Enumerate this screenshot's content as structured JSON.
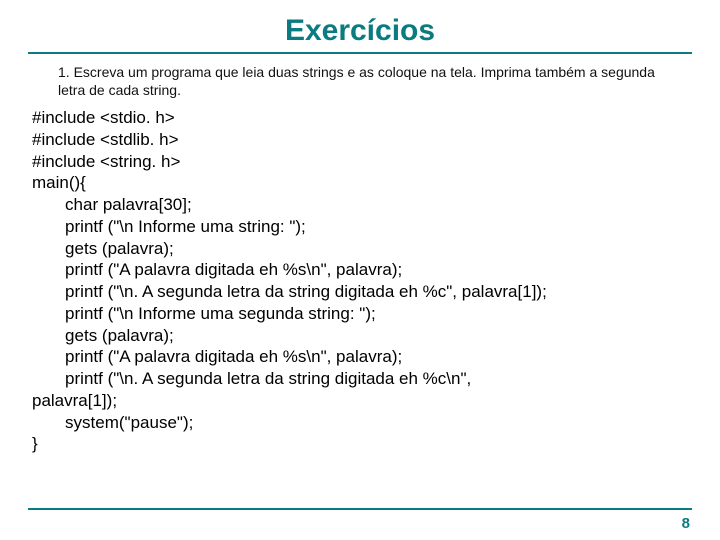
{
  "title": "Exercícios",
  "prompt": "1. Escreva um programa que leia duas strings e as coloque na tela. Imprima também a segunda letra de cada string.",
  "code": "#include <stdio. h>\n#include <stdlib. h>\n#include <string. h>\nmain(){\n       char palavra[30];\n       printf (\"\\n Informe uma string: \");\n       gets (palavra);\n       printf (\"A palavra digitada eh %s\\n\", palavra);\n       printf (\"\\n. A segunda letra da string digitada eh %c\", palavra[1]);\n       printf (\"\\n Informe uma segunda string: \");\n       gets (palavra);\n       printf (\"A palavra digitada eh %s\\n\", palavra);\n       printf (\"\\n. A segunda letra da string digitada eh %c\\n\",\npalavra[1]);\n       system(\"pause\");\n}",
  "page_number": "8"
}
